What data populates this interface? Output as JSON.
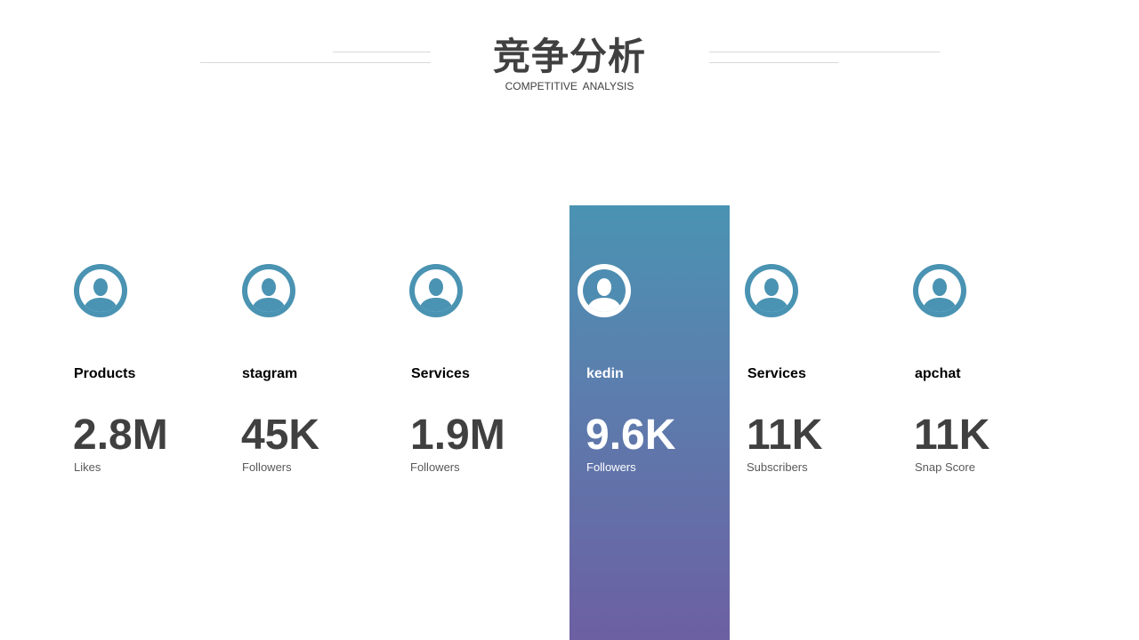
{
  "header": {
    "title": "竞争分析",
    "subtitle": "COMPETITIVE  ANALYSIS"
  },
  "colors": {
    "accent": "#4a93b2",
    "highlight_top": "#4a93b2",
    "highlight_bottom": "#6c5fa2",
    "text_dark": "#404040",
    "line": "#d9d9d9"
  },
  "competitors": [
    {
      "name": "Products",
      "value": "2.8M",
      "metric": "Likes",
      "icon": "user-avatar-icon",
      "highlighted": false
    },
    {
      "name": "stagram",
      "value": "45K",
      "metric": "Followers",
      "icon": "user-avatar-icon",
      "highlighted": false
    },
    {
      "name": "Services",
      "value": "1.9M",
      "metric": "Followers",
      "icon": "user-avatar-icon",
      "highlighted": false
    },
    {
      "name": "kedin",
      "value": "9.6K",
      "metric": "Followers",
      "icon": "user-avatar-icon",
      "highlighted": true
    },
    {
      "name": "Services",
      "value": "11K",
      "metric": "Subscribers",
      "icon": "user-avatar-icon",
      "highlighted": false
    },
    {
      "name": "apchat",
      "value": "11K",
      "metric": "Snap Score",
      "icon": "user-avatar-icon",
      "highlighted": false
    }
  ]
}
